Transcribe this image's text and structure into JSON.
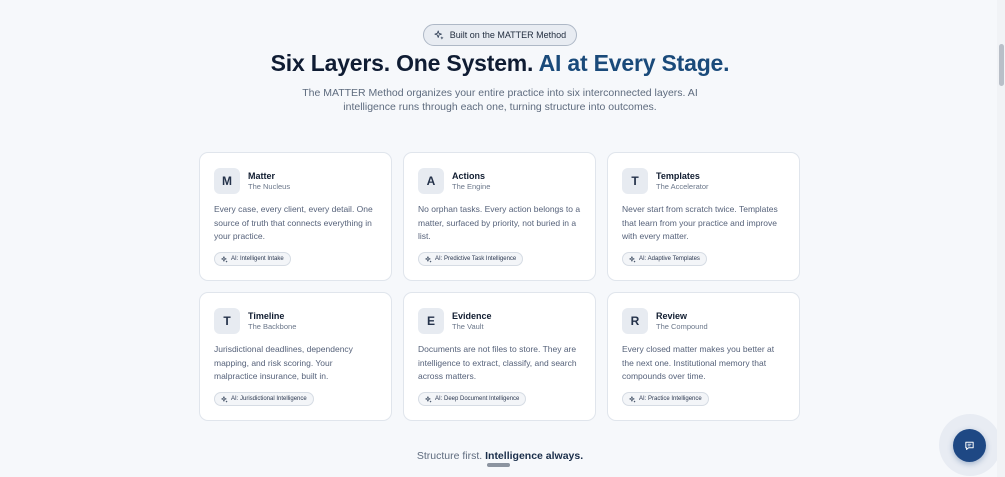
{
  "hero": {
    "badge_label": "Built on the MATTER Method",
    "badge_icon": "sparkle-icon",
    "headline_main": "Six Layers. One System.",
    "headline_accent": "AI at Every Stage.",
    "subtitle": "The MATTER Method organizes your entire practice into six interconnected layers. AI intelligence runs through each one, turning structure into outcomes."
  },
  "layers": [
    {
      "letter": "M",
      "title": "Matter",
      "subtitle": "The Nucleus",
      "description": "Every case, every client, every detail. One source of truth that connects everything in your practice.",
      "ai_label": "AI: Intelligent Intake"
    },
    {
      "letter": "A",
      "title": "Actions",
      "subtitle": "The Engine",
      "description": "No orphan tasks. Every action belongs to a matter, surfaced by priority, not buried in a list.",
      "ai_label": "AI: Predictive Task Intelligence"
    },
    {
      "letter": "T",
      "title": "Templates",
      "subtitle": "The Accelerator",
      "description": "Never start from scratch twice. Templates that learn from your practice and improve with every matter.",
      "ai_label": "AI: Adaptive Templates"
    },
    {
      "letter": "T",
      "title": "Timeline",
      "subtitle": "The Backbone",
      "description": "Jurisdictional deadlines, dependency mapping, and risk scoring. Your malpractice insurance, built in.",
      "ai_label": "AI: Jurisdictional Intelligence"
    },
    {
      "letter": "E",
      "title": "Evidence",
      "subtitle": "The Vault",
      "description": "Documents are not files to store. They are intelligence to extract, classify, and search across matters.",
      "ai_label": "AI: Deep Document Intelligence"
    },
    {
      "letter": "R",
      "title": "Review",
      "subtitle": "The Compound",
      "description": "Every closed matter makes you better at the next one. Institutional memory that compounds over time.",
      "ai_label": "AI: Practice Intelligence"
    }
  ],
  "footer": {
    "tagline_plain": "Structure first.",
    "tagline_strong": "Intelligence always."
  },
  "chat": {
    "icon": "chat-bubble-icon",
    "color": "#1e4884"
  },
  "colors": {
    "accent": "#1a4a7a",
    "background": "#f6f8fb"
  }
}
